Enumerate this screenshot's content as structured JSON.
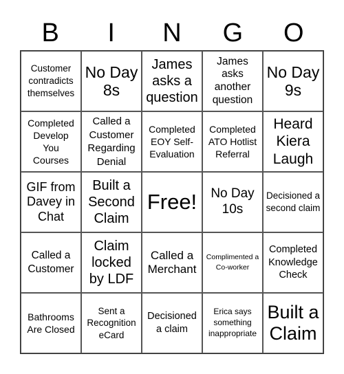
{
  "header": {
    "letters": [
      "B",
      "I",
      "N",
      "G",
      "O"
    ]
  },
  "board": {
    "cells": [
      "Customer contradicts themselves",
      "No Day 8s",
      "James asks a question",
      "James asks another question",
      "No Day 9s",
      "Completed Develop You Courses",
      "Called a Customer Regarding Denial",
      "Completed EOY Self-Evaluation",
      "Completed ATO Hotlist Referral",
      "Heard Kiera Laugh",
      "GIF from Davey in Chat",
      "Built a Second Claim",
      "Free!",
      "No Day 10s",
      "Decisioned a second claim",
      "Called a Customer",
      "Claim locked by LDF",
      "Called a Merchant",
      "Complimented a Co-worker",
      "Completed Knowledge Check",
      "Bathrooms Are Closed",
      "Sent a Recognition eCard",
      "Decisioned a claim",
      "Erica says something inappropriate",
      "Built a Claim"
    ]
  }
}
